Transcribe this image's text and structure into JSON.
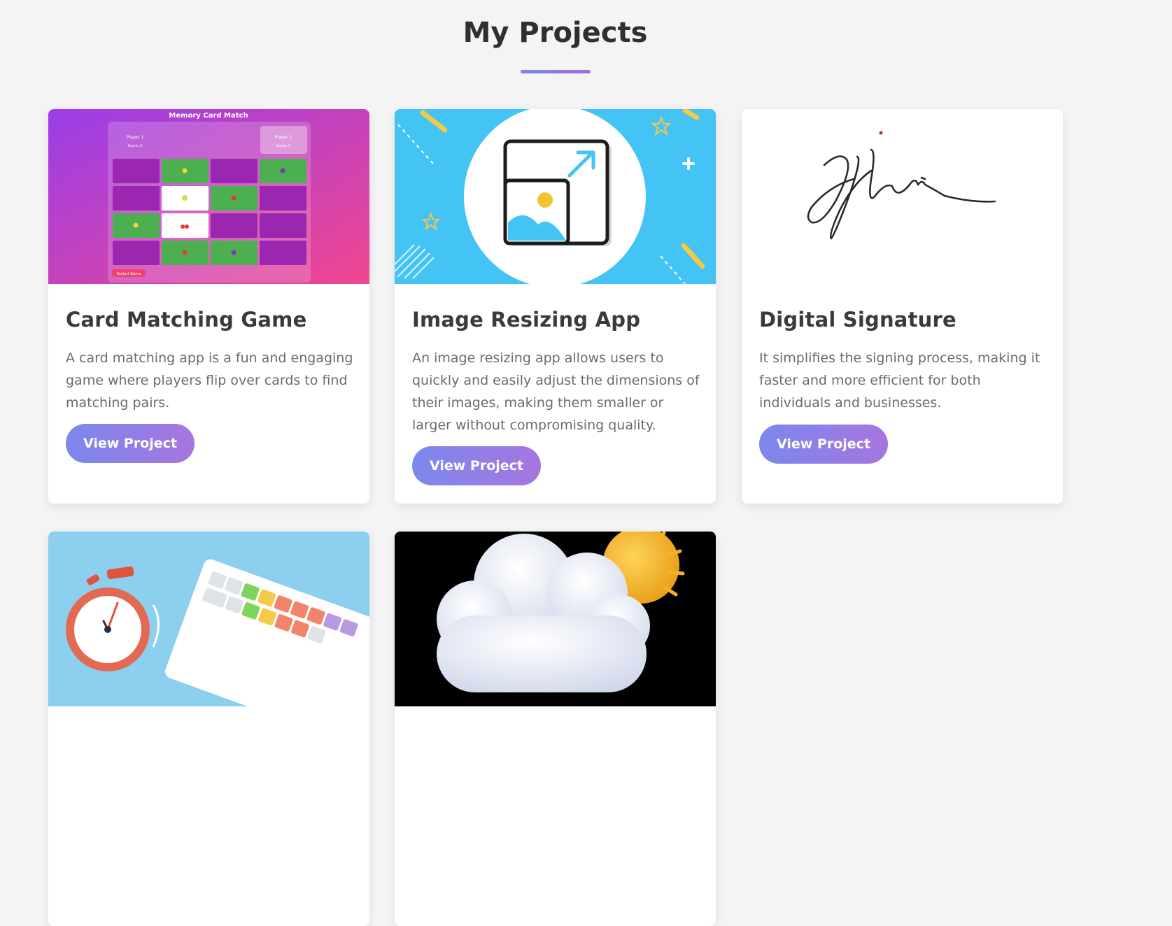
{
  "page": {
    "title": "My Projects"
  },
  "projects": [
    {
      "title": "Card Matching Game",
      "description": "A card matching app is a fun and engaging game where players flip over cards to find matching pairs.",
      "button_label": "View Project",
      "thumbnail": {
        "heading": "Memory Card Match",
        "player1_label": "Player 1",
        "player1_score": "Score: 2",
        "player2_label": "Player 2",
        "player2_score": "Score: 1",
        "restart_label": "Restart Game"
      }
    },
    {
      "title": "Image Resizing App",
      "description": "An image resizing app allows users to quickly and easily adjust the dimensions of their images, making them smaller or larger without compromising quality.",
      "button_label": "View Project"
    },
    {
      "title": "Digital Signature",
      "description": "It simplifies the signing process, making it faster and more efficient for both individuals and businesses.",
      "button_label": "View Project"
    },
    {
      "thumbnail_icons": [
        "stopwatch-icon",
        "keyboard-icon"
      ]
    },
    {
      "thumbnail_icons": [
        "cloud-icon",
        "sun-icon"
      ]
    }
  ],
  "colors": {
    "accent_start": "#7b88ec",
    "accent_end": "#a775e0",
    "background": "#f4f4f4",
    "card_match_gradient_start": "#9a3ee8",
    "card_match_gradient_end": "#f0468f",
    "resize_bg": "#43c4f5",
    "typing_bg": "#8ccfee",
    "weather_bg": "#000000"
  }
}
